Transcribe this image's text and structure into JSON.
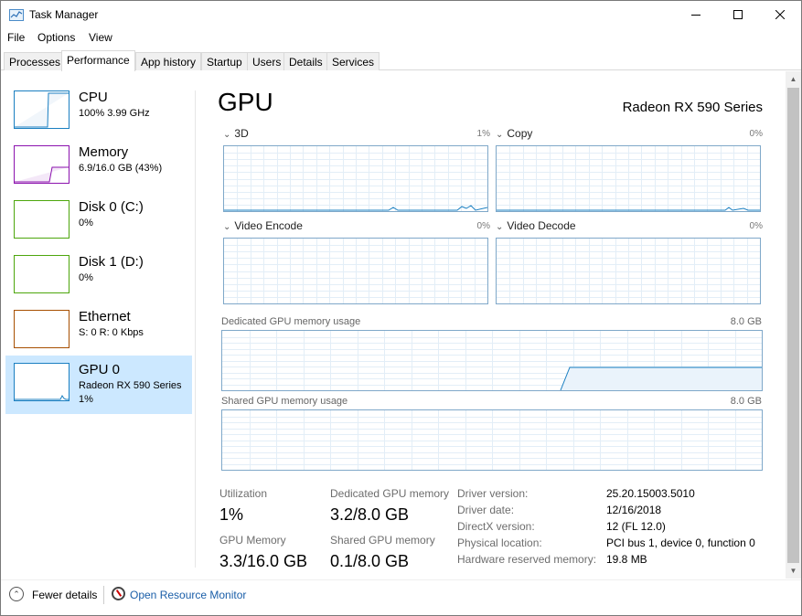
{
  "window": {
    "title": "Task Manager"
  },
  "menu": {
    "file": "File",
    "options": "Options",
    "view": "View"
  },
  "tabs": [
    "Processes",
    "Performance",
    "App history",
    "Startup",
    "Users",
    "Details",
    "Services"
  ],
  "sidebar": {
    "items": [
      {
        "name": "CPU",
        "sub": "100%  3.99 GHz",
        "sub2": ""
      },
      {
        "name": "Memory",
        "sub": "6.9/16.0 GB (43%)",
        "sub2": ""
      },
      {
        "name": "Disk 0 (C:)",
        "sub": "0%",
        "sub2": ""
      },
      {
        "name": "Disk 1 (D:)",
        "sub": "0%",
        "sub2": ""
      },
      {
        "name": "Ethernet",
        "sub": "S: 0  R: 0 Kbps",
        "sub2": ""
      },
      {
        "name": "GPU 0",
        "sub": "Radeon RX 590 Series",
        "sub2": "1%"
      }
    ]
  },
  "main": {
    "title": "GPU",
    "device": "Radeon RX 590 Series",
    "engines": [
      {
        "label": "3D",
        "pct": "1%"
      },
      {
        "label": "Copy",
        "pct": "0%"
      },
      {
        "label": "Video Encode",
        "pct": "0%"
      },
      {
        "label": "Video Decode",
        "pct": "0%"
      }
    ],
    "dedicated_label": "Dedicated GPU memory usage",
    "dedicated_max": "8.0 GB",
    "shared_label": "Shared GPU memory usage",
    "shared_max": "8.0 GB"
  },
  "stats": {
    "utilization_label": "Utilization",
    "utilization_value": "1%",
    "dedicated_label": "Dedicated GPU memory",
    "dedicated_value": "3.2/8.0 GB",
    "gpu_memory_label": "GPU Memory",
    "gpu_memory_value": "3.3/16.0 GB",
    "shared_label": "Shared GPU memory",
    "shared_value": "0.1/8.0 GB"
  },
  "info": [
    {
      "label": "Driver version:",
      "value": "25.20.15003.5010"
    },
    {
      "label": "Driver date:",
      "value": "12/16/2018"
    },
    {
      "label": "DirectX version:",
      "value": "12 (FL 12.0)"
    },
    {
      "label": "Physical location:",
      "value": "PCI bus 1, device 0, function 0"
    },
    {
      "label": "Hardware reserved memory:",
      "value": "19.8 MB"
    }
  ],
  "footer": {
    "fewer": "Fewer details",
    "monitor": "Open Resource Monitor"
  },
  "colors": {
    "cpu": "#1a7fc1",
    "memory": "#8b12ae",
    "disk": "#4da60c",
    "ethernet": "#a74f01",
    "gpu": "#1a7fc1",
    "accent": "#1a5ea8"
  }
}
